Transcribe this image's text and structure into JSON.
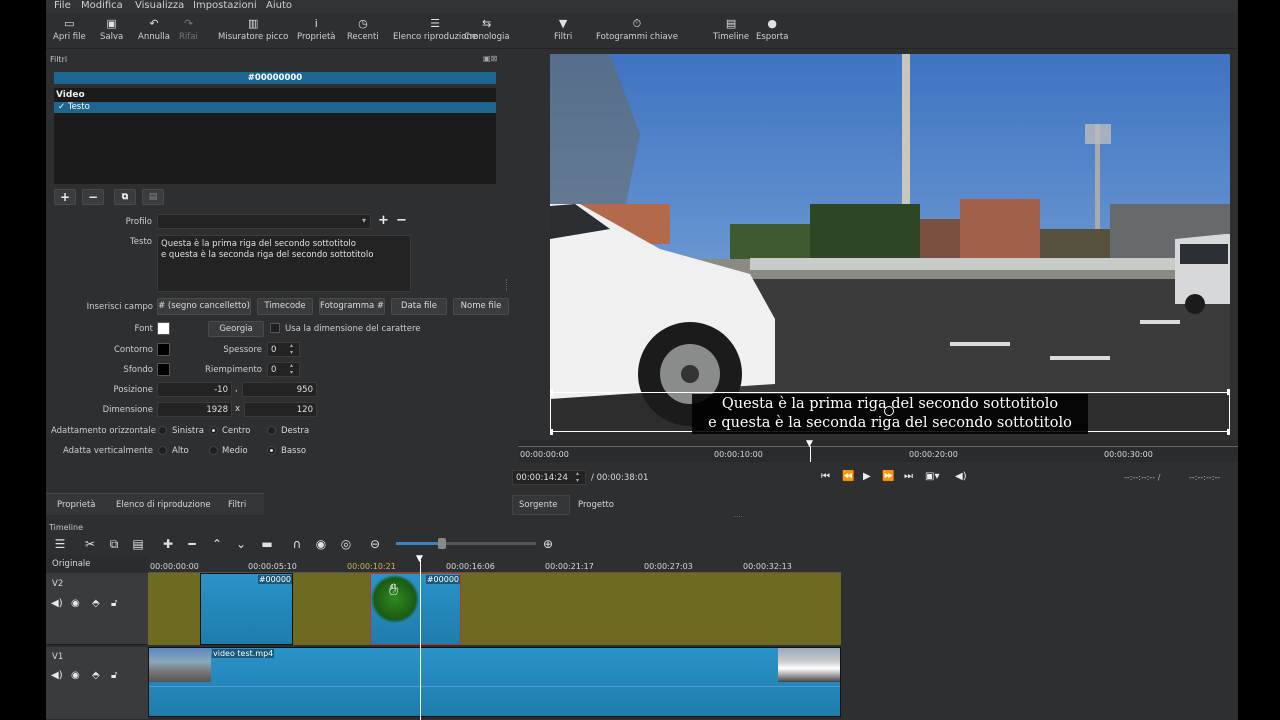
{
  "menu": [
    "File",
    "Modifica",
    "Visualizza",
    "Impostazioni",
    "Aiuto"
  ],
  "toolbar": [
    {
      "label": "Apri file",
      "icon": "open-file-icon",
      "glyph": "▭",
      "enabled": true
    },
    {
      "label": "Salva",
      "icon": "save-icon",
      "glyph": "▣",
      "enabled": true
    },
    {
      "label": "Annulla",
      "icon": "undo-icon",
      "glyph": "↶",
      "enabled": true
    },
    {
      "label": "Rifai",
      "icon": "redo-icon",
      "glyph": "↷",
      "enabled": false
    },
    {
      "label": "Misuratore picco",
      "icon": "peak-meter-icon",
      "glyph": "▥",
      "enabled": true
    },
    {
      "label": "Proprietà",
      "icon": "info-icon",
      "glyph": "i",
      "enabled": true
    },
    {
      "label": "Recenti",
      "icon": "clock-icon",
      "glyph": "◷",
      "enabled": true
    },
    {
      "label": "Elenco riproduzione",
      "icon": "playlist-icon",
      "glyph": "☰",
      "enabled": true
    },
    {
      "label": "Cronologia",
      "icon": "history-icon",
      "glyph": "⇆",
      "enabled": true
    },
    {
      "label": "Filtri",
      "icon": "filter-icon",
      "glyph": "▼",
      "enabled": true
    },
    {
      "label": "Fotogrammi chiave",
      "icon": "keyframes-icon",
      "glyph": "⏱",
      "enabled": true
    },
    {
      "label": "Timeline",
      "icon": "timeline-icon",
      "glyph": "▤",
      "enabled": true
    },
    {
      "label": "Esporta",
      "icon": "export-icon",
      "glyph": "●",
      "enabled": true
    }
  ],
  "filters": {
    "title": "Filtri",
    "color_value": "#00000000",
    "category": "Video",
    "items": [
      {
        "label": "✓ Testo"
      }
    ]
  },
  "text_filter": {
    "profile_label": "Profilo",
    "text_label": "Testo",
    "text_lines": [
      "Questa è la prima riga del secondo sottotitolo",
      "e questa è la seconda riga del secondo sottotitolo"
    ],
    "insert_field_label": "Inserisci campo",
    "insert_buttons": [
      "# (segno cancelletto)",
      "Timecode",
      "Fotogramma #",
      "Data file",
      "Nome file"
    ],
    "font_label": "Font",
    "font_name": "Georgia",
    "use_size_label": "Usa la dimensione del carattere",
    "outline_label": "Contorno",
    "thickness_label": "Spessore",
    "thickness_value": "0",
    "background_label": "Sfondo",
    "padding_label": "Riempimento",
    "padding_value": "0",
    "position_label": "Posizione",
    "position_x": "-10",
    "position_y": "950",
    "position_sep": ",",
    "size_label": "Dimensione",
    "size_w": "1928",
    "size_h": "120",
    "size_sep": "x",
    "halign_label": "Adattamento orizzontale",
    "halign_options": [
      "Sinistra",
      "Centro",
      "Destra"
    ],
    "halign_selected": "Centro",
    "valign_label": "Adatta verticalmente",
    "valign_options": [
      "Alto",
      "Medio",
      "Basso"
    ],
    "valign_selected": "Basso"
  },
  "left_tabs": [
    "Proprietà",
    "Elenco di riproduzione",
    "Filtri"
  ],
  "player": {
    "subtitle_lines": [
      "Questa è la prima riga del secondo sottotitolo",
      "e questa è la seconda riga del secondo sottotitolo"
    ],
    "ruler": [
      "00:00:00:00",
      "00:00:10:00",
      "00:00:20:00",
      "00:00:30:00"
    ],
    "current_time": "00:00:14:24",
    "total_time": "/ 00:00:38:01",
    "in_point": "--:--:--:-- /",
    "out_point": "--:--:--:--",
    "tabs": [
      "Sorgente",
      "Progetto"
    ]
  },
  "timeline": {
    "title": "Timeline",
    "header_label": "Originale",
    "ruler": [
      "00:00:00:00",
      "00:00:05:10",
      "00:00:10:21",
      "00:00:16:06",
      "00:00:21:17",
      "00:00:27:03",
      "00:00:32:13"
    ],
    "tracks": [
      {
        "name": "V2",
        "clips": [
          {
            "label": "#00000"
          },
          {
            "label": "#00000"
          }
        ]
      },
      {
        "name": "V1",
        "clips": [
          {
            "label": "video test.mp4"
          }
        ]
      }
    ]
  }
}
